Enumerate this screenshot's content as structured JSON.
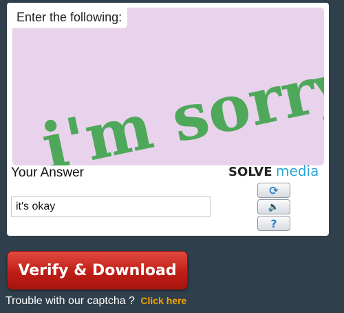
{
  "captcha": {
    "prompt": "Enter the following:",
    "challenge_text": "i'm sorry",
    "answer_label": "Your Answer",
    "answer_value": "it's okay",
    "brand_solve": "SOLVE",
    "brand_media": "media",
    "controls": [
      {
        "name": "refresh-icon",
        "glyph": "⟳"
      },
      {
        "name": "audio-icon",
        "glyph": "🔈"
      },
      {
        "name": "help-icon",
        "glyph": "?"
      }
    ]
  },
  "actions": {
    "verify_label": "Verify & Download",
    "trouble_text": "Trouble with our captcha ?",
    "click_here_label": "Click here"
  },
  "colors": {
    "background": "#2f3f4b",
    "challenge_bg": "#e9d2ec",
    "captcha_text": "#4ea85a",
    "brand_accent": "#2ea4d8",
    "verify_button": "#bf1e16",
    "link": "#f2a400"
  }
}
